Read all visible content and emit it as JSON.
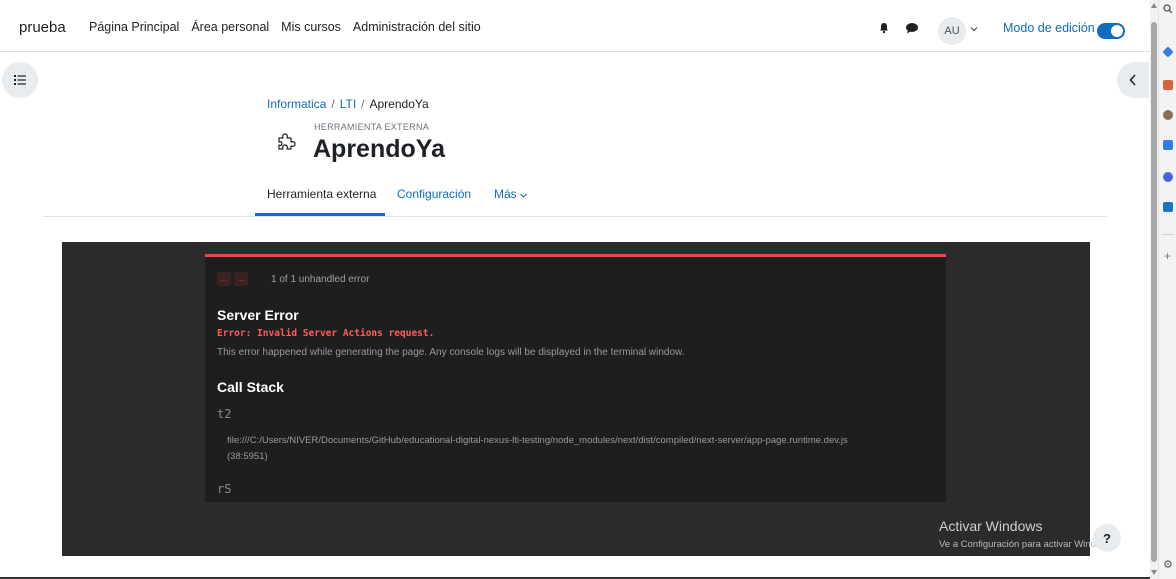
{
  "navbar": {
    "brand": "prueba",
    "links": [
      "Página Principal",
      "Área personal",
      "Mis cursos",
      "Administración del sitio"
    ],
    "avatar_initials": "AU",
    "edit_mode_label": "Modo de edición",
    "edit_mode_on": true
  },
  "breadcrumb": {
    "items": [
      "Informatica",
      "LTI",
      "AprendoYa"
    ]
  },
  "header": {
    "overline": "HERRAMIENTA EXTERNA",
    "title": "AprendoYa"
  },
  "tabs": [
    {
      "label": "Herramienta externa",
      "active": true
    },
    {
      "label": "Configuración",
      "active": false
    },
    {
      "label": "Más",
      "active": false
    }
  ],
  "error_overlay": {
    "count_text": "1 of 1 unhandled error",
    "title": "Server Error",
    "message": "Error: Invalid Server Actions request.",
    "description": "This error happened while generating the page. Any console logs will be displayed in the terminal window.",
    "stack_title": "Call Stack",
    "frames": [
      {
        "name": "t2",
        "path": "file:///C:/Users/NIVER/Documents/GitHub/educational-digital-nexus-lti-testing/node_modules/next/dist/compiled/next-server/app-page.runtime.dev.js (38:5951)"
      },
      {
        "name": "rS",
        "path": ""
      }
    ]
  },
  "watermark": {
    "title": "Activar Windows",
    "subtitle": "Ve a Configuración para activar Windows."
  },
  "help_label": "?",
  "colors": {
    "accent": "#0f6cbf",
    "error_red": "#e5484d",
    "frame_bg": "#2b2b2b"
  },
  "icons": {
    "left_drawer": "list-icon",
    "right_drawer": "chevron-left-icon",
    "notifications": "bell-icon",
    "messages": "chat-icon",
    "activity": "puzzle-icon"
  }
}
